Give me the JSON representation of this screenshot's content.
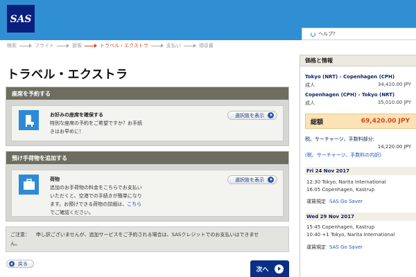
{
  "header": {
    "logo_text": "SAS",
    "help_label": "ヘルプ?",
    "brand_color": "#2f8fd2",
    "logo_color": "#0a1f7c"
  },
  "breadcrumb": [
    {
      "label": "検索",
      "active": false
    },
    {
      "label": "フライト",
      "active": false
    },
    {
      "label": "旅客",
      "active": false
    },
    {
      "label": "トラベル・エクストラ",
      "active": true
    },
    {
      "label": "支払い",
      "active": false
    },
    {
      "label": "領収書",
      "active": false
    }
  ],
  "page_title": "トラベル・エクストラ",
  "seat_panel": {
    "header": "座席を予約する",
    "icon": "seat-icon",
    "title": "お好みの座席を確保する",
    "line1": "特別な座席の予約をご希望ですか？お手続",
    "line2": "きはお早めに！",
    "button": "選択肢を表示"
  },
  "baggage_panel": {
    "header": "預け手荷物を追加する",
    "icon": "suitcase-icon",
    "title": "荷物",
    "line1": "追加のお手荷物の料金をこちらでお支払い",
    "line2": "いただくと、空港での手続きが簡単になり",
    "line3": "ます。お預けできる荷物の詳細は、",
    "link": "こちら",
    "line4": "でご確認ください。",
    "button": "選択肢を表示"
  },
  "notice": {
    "label": "ご注意：",
    "line1": "申し訳ございませんが、追加サービスをご予約される場合は、SASクレジットでのお支払いはできませ",
    "line2": "ん。"
  },
  "nav": {
    "back": "戻る",
    "next": "次へ"
  },
  "sidebar": {
    "title": "価格と情報",
    "flights": [
      {
        "route": "Tokyo (NRT) - Copenhagen (CPH)",
        "passenger": "成人",
        "price": "34,410.00 JPY"
      },
      {
        "route": "Copenhagen (CPH) - Tokyo (NRT)",
        "passenger": "成人",
        "price": "35,010.00 JPY"
      }
    ],
    "total_label": "総額",
    "total_value": "69,420.00 JPY",
    "tax_line1": "税、サーチャージ、手数料部分:",
    "tax_value": "14,220.00 JPY",
    "tax_link": "(税、サーチャージ、手数料の内訳)",
    "legs": [
      {
        "date": "Fri 24 Nov 2017",
        "dep": "12:30  Tokyo, Narita International",
        "arr": "16:05  Copenhagen, Kastrup",
        "rule_label": "運賃規定",
        "rule_link": "SAS Go Saver"
      },
      {
        "date": "Wed 29 Nov 2017",
        "dep": "15:45  Copenhagen, Kastrup",
        "arr": "10:40   +1  Tokyo, Narita International",
        "rule_label": "運賃規定",
        "rule_link": "SAS Go Saver"
      }
    ]
  }
}
